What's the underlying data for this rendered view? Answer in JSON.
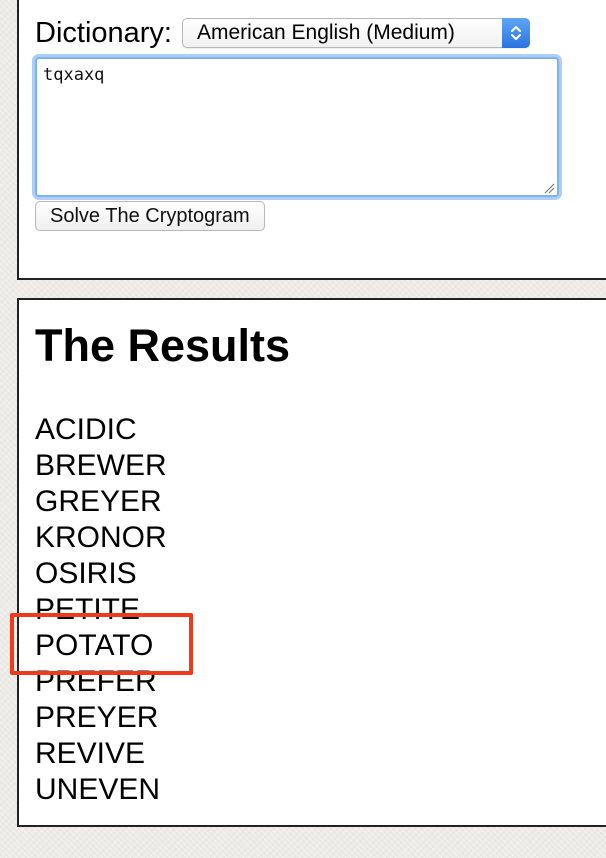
{
  "form": {
    "dictionary_label": "Dictionary:",
    "dictionary_selected": "American English (Medium)",
    "cipher_text": "tqxaxq",
    "solve_button_label": "Solve The Cryptogram"
  },
  "results": {
    "title": "The Results",
    "words": [
      "ACIDIC",
      "BREWER",
      "GREYER",
      "KRONOR",
      "OSIRIS",
      "PETITE",
      "POTATO",
      "PREFER",
      "PREYER",
      "REVIVE",
      "UNEVEN"
    ],
    "highlighted_word": "POTATO"
  },
  "colors": {
    "highlight": "#f03a1a",
    "focus_ring": "#7ab2f5",
    "select_arrow": "#2b73e0"
  },
  "icons": {
    "select_arrows": "chevron-updown-icon",
    "resize_grip": "resize-grip-icon"
  }
}
